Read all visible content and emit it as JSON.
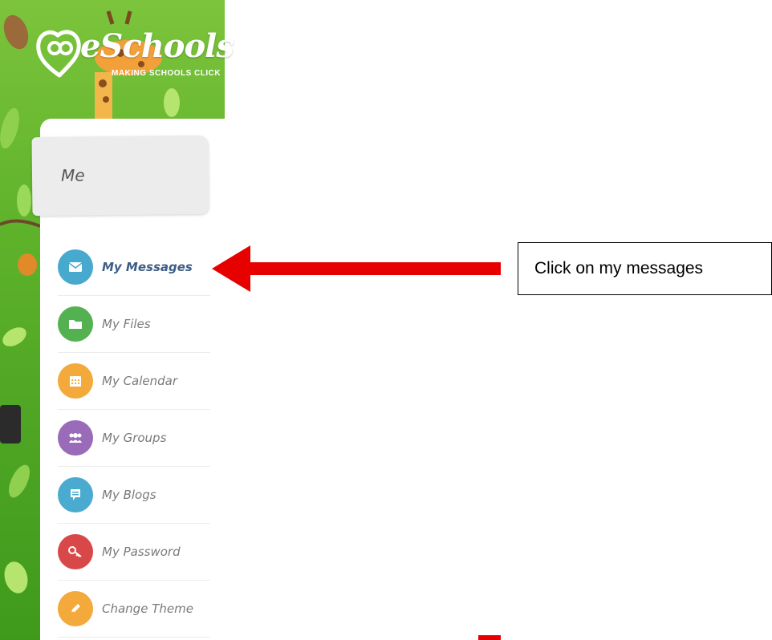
{
  "logo": {
    "brand": "eSchools",
    "tagline": "MAKING SCHOOLS CLICK"
  },
  "me_tab": {
    "label": "Me"
  },
  "menu": [
    {
      "label": "My Messages",
      "icon": "envelope-icon",
      "color": "#48a9cf",
      "active": true
    },
    {
      "label": "My Files",
      "icon": "folder-icon",
      "color": "#54b151",
      "active": false
    },
    {
      "label": "My Calendar",
      "icon": "calendar-icon",
      "color": "#f4a93b",
      "active": false
    },
    {
      "label": "My Groups",
      "icon": "users-icon",
      "color": "#9a6bb8",
      "active": false
    },
    {
      "label": "My Blogs",
      "icon": "blog-icon",
      "color": "#4aaad0",
      "active": false
    },
    {
      "label": "My Password",
      "icon": "key-icon",
      "color": "#d94848",
      "active": false
    },
    {
      "label": "Change Theme",
      "icon": "pencil-icon",
      "color": "#f4a93b",
      "active": false
    }
  ],
  "annotation": {
    "callout_text": "Click on my messages",
    "arrow_color": "#e60000"
  }
}
